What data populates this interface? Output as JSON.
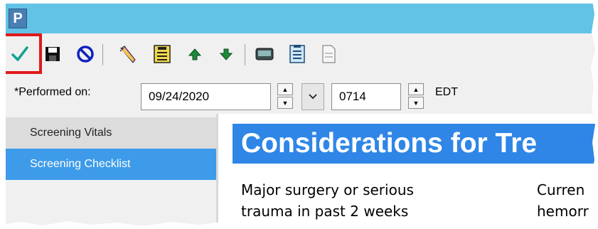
{
  "titlebar": {
    "app_letter": "P"
  },
  "toolbar": {
    "buttons": [
      {
        "icon": "checkmark-icon",
        "color": "#12a38f"
      },
      {
        "icon": "save-icon"
      },
      {
        "icon": "cancel-icon",
        "color": "#1020c0"
      },
      {
        "icon": "pencil-icon"
      },
      {
        "icon": "form-icon"
      },
      {
        "icon": "arrow-up-icon",
        "color": "#1c8a3a"
      },
      {
        "icon": "arrow-down-icon",
        "color": "#1c8a3a"
      },
      {
        "icon": "keyboard-icon"
      },
      {
        "icon": "checklist-icon"
      },
      {
        "icon": "document-icon"
      }
    ],
    "highlight_color": "#e0191c"
  },
  "performed": {
    "label": "*Performed on:",
    "date": "09/24/2020",
    "time": "0714",
    "timezone": "EDT"
  },
  "sidebar": {
    "items": [
      {
        "label": "Screening Vitals",
        "selected": false
      },
      {
        "label": "Screening Checklist",
        "selected": true
      }
    ]
  },
  "content": {
    "heading": "Considerations for Tre",
    "col1_text": "Major surgery or serious\ntrauma in past 2 weeks",
    "col2_text": "Curren\nhemorr"
  },
  "colors": {
    "titlebar": "#62c3e6",
    "selected": "#3d9be9",
    "banner": "#2f86e6"
  }
}
